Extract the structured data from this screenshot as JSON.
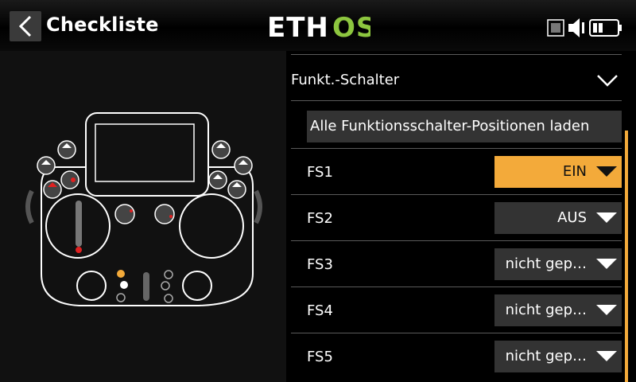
{
  "header": {
    "title": "Checkliste",
    "logo_text": "ETHOS"
  },
  "section": {
    "label": "Funkt.-Schalter"
  },
  "load_button": {
    "label": "Alle Funktionsschalter-Positionen laden"
  },
  "switches": [
    {
      "label": "FS1",
      "value": "EIN",
      "active": true
    },
    {
      "label": "FS2",
      "value": "AUS",
      "active": false
    },
    {
      "label": "FS3",
      "value": "nicht gep…",
      "active": false
    },
    {
      "label": "FS4",
      "value": "nicht gep…",
      "active": false
    },
    {
      "label": "FS5",
      "value": "nicht gep…",
      "active": false
    }
  ],
  "colors": {
    "accent": "#f3aa3a",
    "logo_green": "#8dc63f",
    "marker_red": "#e02020",
    "panel": "#333333"
  },
  "icons": {
    "back": "chevron-left-icon",
    "collapse": "chevron-down-icon",
    "sd_card": "sd-card-icon",
    "speaker": "speaker-icon",
    "battery": "battery-icon"
  }
}
